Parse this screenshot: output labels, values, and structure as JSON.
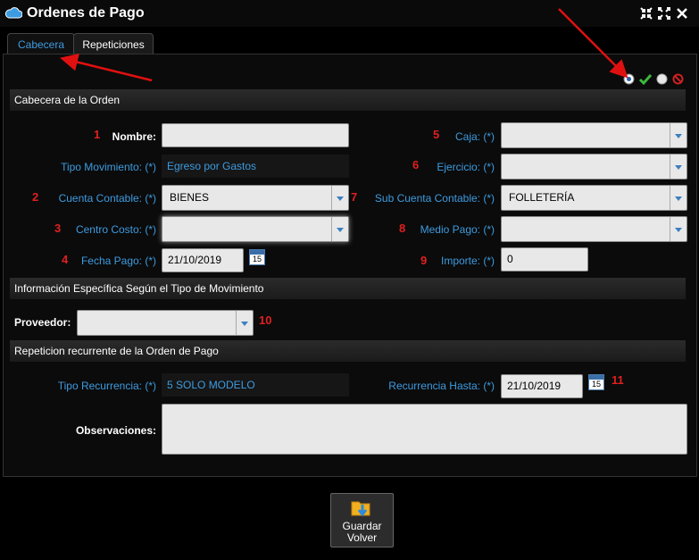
{
  "window": {
    "title": "Ordenes de Pago"
  },
  "tabs": [
    {
      "label": "Cabecera"
    },
    {
      "label": "Repeticiones"
    }
  ],
  "sections": {
    "header": "Cabecera de la Orden",
    "specific": "Información Específica Según el Tipo de Movimiento",
    "recurrence": "Repeticion recurrente de la Orden de Pago"
  },
  "markers": [
    "1",
    "2",
    "3",
    "4",
    "5",
    "6",
    "7",
    "8",
    "9",
    "10",
    "11"
  ],
  "form": {
    "nombre_label": "Nombre:",
    "tipo_mov_label": "Tipo Movimiento: (*)",
    "tipo_mov_value": "Egreso por Gastos",
    "cuenta_label": "Cuenta Contable: (*)",
    "cuenta_value": "BIENES",
    "centro_label": "Centro Costo: (*)",
    "fecha_label": "Fecha Pago: (*)",
    "fecha_value": "21/10/2019",
    "caja_label": "Caja: (*)",
    "ejercicio_label": "Ejercicio: (*)",
    "subcuenta_label": "Sub Cuenta Contable: (*)",
    "subcuenta_value": "FOLLETERÍA",
    "medio_label": "Medio Pago: (*)",
    "importe_label": "Importe: (*)",
    "importe_value": "0",
    "proveedor_label": "Proveedor:",
    "tipo_rec_label": "Tipo Recurrencia: (*)",
    "tipo_rec_value": "5 SOLO MODELO",
    "rec_hasta_label": "Recurrencia Hasta: (*)",
    "rec_hasta_value": "21/10/2019",
    "observaciones_label": "Observaciones:",
    "calendar_day": "15"
  },
  "save_button": {
    "line1": "Guardar",
    "line2": "Volver"
  },
  "colors": {
    "accent": "#3d9be0",
    "marker": "#e02020",
    "arrow": "#e01010"
  }
}
